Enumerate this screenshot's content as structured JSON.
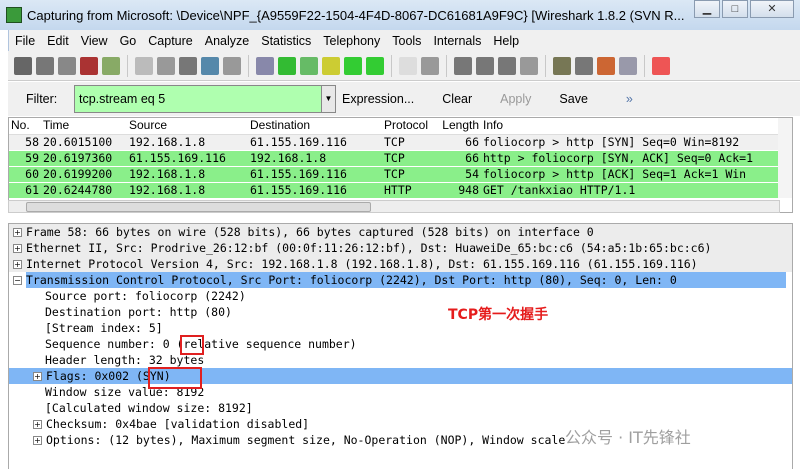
{
  "window": {
    "title": "Capturing from Microsoft: \\Device\\NPF_{A9559F22-1504-4F4D-8067-DC61681A9F9C}    [Wireshark 1.8.2  (SVN R...",
    "controls": [
      "minimize",
      "maximize",
      "close"
    ]
  },
  "menu": [
    "File",
    "Edit",
    "View",
    "Go",
    "Capture",
    "Analyze",
    "Statistics",
    "Telephony",
    "Tools",
    "Internals",
    "Help"
  ],
  "toolbar": [
    "interfaces-icon",
    "options-icon",
    "start-icon",
    "stop-icon",
    "restart-icon",
    "open-icon",
    "save-icon",
    "close-file-icon",
    "reload-icon",
    "print-icon",
    "find-icon",
    "back-icon",
    "forward-icon",
    "goto-icon",
    "first-icon",
    "last-icon",
    "colorize-icon",
    "autoscroll-icon",
    "zoom-in-icon",
    "zoom-out-icon",
    "zoom-normal-icon",
    "resize-columns-icon",
    "capture-filters-icon",
    "display-filters-icon",
    "coloring-rules-icon",
    "preferences-icon",
    "help-icon"
  ],
  "filter": {
    "label": "Filter:",
    "value": "tcp.stream eq 5",
    "expression": "Expression...",
    "clear": "Clear",
    "apply": "Apply",
    "save": "Save",
    "more": "»"
  },
  "packet_list": {
    "columns": [
      "No.",
      "Time",
      "Source",
      "Destination",
      "Protocol",
      "Length",
      "Info"
    ],
    "rows": [
      {
        "no": "58",
        "time": "20.6015100",
        "src": "192.168.1.8",
        "dst": "61.155.169.116",
        "proto": "TCP",
        "len": "66",
        "info": "foliocorp > http [SYN] Seq=0 Win=8192",
        "color": "#f0f0f0"
      },
      {
        "no": "59",
        "time": "20.6197360",
        "src": "61.155.169.116",
        "dst": "192.168.1.8",
        "proto": "TCP",
        "len": "66",
        "info": "http > foliocorp [SYN, ACK] Seq=0 Ack=1",
        "color": "#8aef8a"
      },
      {
        "no": "60",
        "time": "20.6199200",
        "src": "192.168.1.8",
        "dst": "61.155.169.116",
        "proto": "TCP",
        "len": "54",
        "info": "foliocorp > http [ACK] Seq=1 Ack=1 Win",
        "color": "#8aef8a"
      },
      {
        "no": "61",
        "time": "20.6244780",
        "src": "192.168.1.8",
        "dst": "61.155.169.116",
        "proto": "HTTP",
        "len": "948",
        "info": "GET /tankxiao HTTP/1.1",
        "color": "#8aef8a"
      }
    ]
  },
  "details": {
    "frame": "Frame 58: 66 bytes on wire (528 bits), 66 bytes captured (528 bits) on interface 0",
    "ethernet": "Ethernet II, Src: Prodrive_26:12:bf (00:0f:11:26:12:bf), Dst: HuaweiDe_65:bc:c6 (54:a5:1b:65:bc:c6)",
    "ip": "Internet Protocol Version 4, Src: 192.168.1.8 (192.168.1.8), Dst: 61.155.169.116 (61.155.169.116)",
    "tcp": "Transmission Control Protocol, Src Port: foliocorp (2242), Dst Port: http (80), Seq: 0, Len: 0",
    "src_port": "Source port: foliocorp (2242)",
    "dst_port": "Destination port: http (80)",
    "stream": "[Stream index: 5]",
    "seq": "Sequence number: 0    (relative sequence number)",
    "hdr_len": "Header length: 32 bytes",
    "flags": "Flags: 0x002 (SYN)",
    "window": "Window size value: 8192",
    "calc_window": "[Calculated window size: 8192]",
    "checksum": "Checksum: 0x4bae [validation disabled]",
    "options": "Options: (12 bytes), Maximum segment size, No-Operation (NOP), Window scale"
  },
  "annotation": "TCP第一次握手",
  "watermark": "公众号 · IT先锋社"
}
